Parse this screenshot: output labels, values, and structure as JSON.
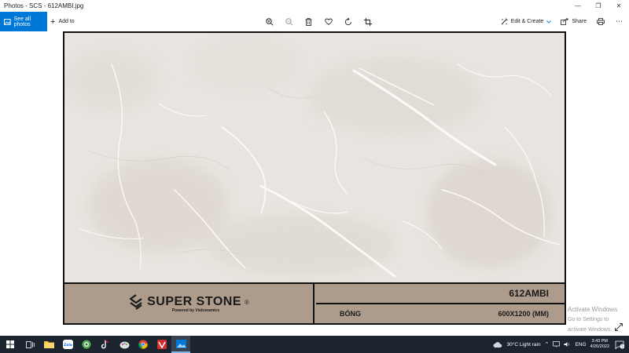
{
  "window": {
    "title": "Photos - SCS - 612AMBI.jpg"
  },
  "toolbar": {
    "see_all_label": "See all photos",
    "add_to_label": "Add to",
    "edit_create_label": "Edit & Create",
    "share_label": "Share"
  },
  "photo": {
    "brand_name": "SUPER STONE",
    "brand_reg": "®",
    "brand_sub": "Powered by Vietceramics",
    "product_code": "612AMBI",
    "finish": "BÓNG",
    "size": "600X1200 (MM)"
  },
  "watermark": {
    "line1": "Activate Windows",
    "line2": "Go to Settings to activate Windows."
  },
  "taskbar": {
    "weather": "30°C  Light rain",
    "lang": "ENG",
    "time": "3:43 PM",
    "date": "4/20/2022",
    "notif_count": "5"
  },
  "colors": {
    "accent": "#0078d7",
    "taskbar": "#1c2430",
    "brand_bar": "#ad9c8c",
    "marble": "#e9e6e1"
  }
}
